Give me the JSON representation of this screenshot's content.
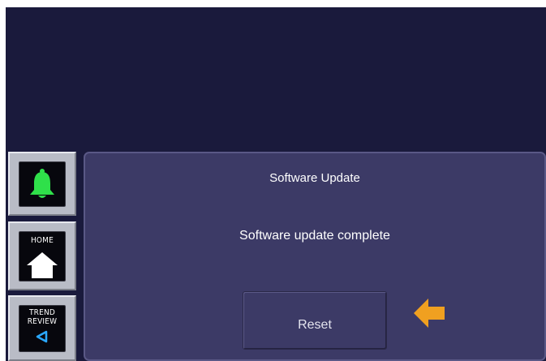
{
  "side_nav": {
    "alarm": {
      "icon": "bell-icon",
      "color": "#2fe04a"
    },
    "home": {
      "label": "HOME",
      "icon": "home-icon"
    },
    "trend_review": {
      "label_line1": "TREND",
      "label_line2": "REVIEW",
      "icon": "triangle-left-icon",
      "icon_color": "#2aa8ff"
    }
  },
  "dialog": {
    "title": "Software Update",
    "message": "Software update complete",
    "reset_label": "Reset",
    "indicator_icon": "arrow-left-icon",
    "indicator_color": "#f0a020"
  },
  "colors": {
    "screen_background": "#1a1a3c",
    "panel_background": "#3c3a66"
  }
}
